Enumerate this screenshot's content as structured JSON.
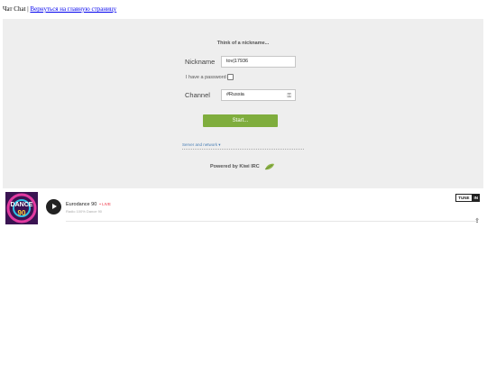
{
  "header": {
    "site_name": "Чат Chat",
    "separator": " | ",
    "home_link": "Вернуться на главную страницу"
  },
  "kiwi": {
    "title": "Think of a nickname...",
    "nickname_label": "Nickname",
    "nickname_value": "tov|17936",
    "password_label": "I have a password",
    "channel_label": "Channel",
    "channel_value": "#Russia",
    "start_button": "Start...",
    "server_network": "Server and network ▾",
    "powered_by": "Powered by Kiwi IRC",
    "colors": {
      "accent": "#7fad3d",
      "panel_bg": "#eeeeee",
      "link": "#4a7fb5"
    }
  },
  "radio": {
    "station_name": "Eurodance 90",
    "live_label": "• LIVE",
    "subtitle": "Radio 100% Dance 90",
    "cover_text": "DANCE 90",
    "tunein_label": "TUNE",
    "tunein_badge": "IN",
    "play_icon": "play-icon",
    "share_icon": "share-icon",
    "colors": {
      "live": "#ee3344"
    }
  }
}
